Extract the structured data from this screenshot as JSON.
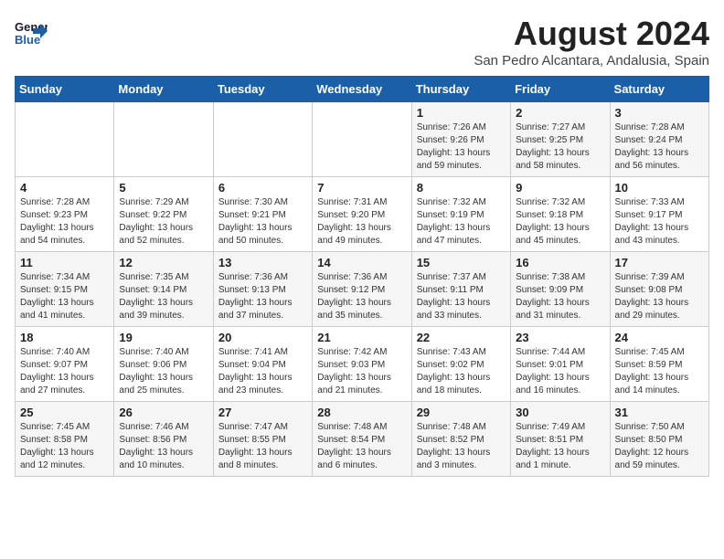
{
  "header": {
    "logo_line1": "General",
    "logo_line2": "Blue",
    "title": "August 2024",
    "subtitle": "San Pedro Alcantara, Andalusia, Spain"
  },
  "days_of_week": [
    "Sunday",
    "Monday",
    "Tuesday",
    "Wednesday",
    "Thursday",
    "Friday",
    "Saturday"
  ],
  "weeks": [
    [
      {
        "day": "",
        "info": ""
      },
      {
        "day": "",
        "info": ""
      },
      {
        "day": "",
        "info": ""
      },
      {
        "day": "",
        "info": ""
      },
      {
        "day": "1",
        "info": "Sunrise: 7:26 AM\nSunset: 9:26 PM\nDaylight: 13 hours\nand 59 minutes."
      },
      {
        "day": "2",
        "info": "Sunrise: 7:27 AM\nSunset: 9:25 PM\nDaylight: 13 hours\nand 58 minutes."
      },
      {
        "day": "3",
        "info": "Sunrise: 7:28 AM\nSunset: 9:24 PM\nDaylight: 13 hours\nand 56 minutes."
      }
    ],
    [
      {
        "day": "4",
        "info": "Sunrise: 7:28 AM\nSunset: 9:23 PM\nDaylight: 13 hours\nand 54 minutes."
      },
      {
        "day": "5",
        "info": "Sunrise: 7:29 AM\nSunset: 9:22 PM\nDaylight: 13 hours\nand 52 minutes."
      },
      {
        "day": "6",
        "info": "Sunrise: 7:30 AM\nSunset: 9:21 PM\nDaylight: 13 hours\nand 50 minutes."
      },
      {
        "day": "7",
        "info": "Sunrise: 7:31 AM\nSunset: 9:20 PM\nDaylight: 13 hours\nand 49 minutes."
      },
      {
        "day": "8",
        "info": "Sunrise: 7:32 AM\nSunset: 9:19 PM\nDaylight: 13 hours\nand 47 minutes."
      },
      {
        "day": "9",
        "info": "Sunrise: 7:32 AM\nSunset: 9:18 PM\nDaylight: 13 hours\nand 45 minutes."
      },
      {
        "day": "10",
        "info": "Sunrise: 7:33 AM\nSunset: 9:17 PM\nDaylight: 13 hours\nand 43 minutes."
      }
    ],
    [
      {
        "day": "11",
        "info": "Sunrise: 7:34 AM\nSunset: 9:15 PM\nDaylight: 13 hours\nand 41 minutes."
      },
      {
        "day": "12",
        "info": "Sunrise: 7:35 AM\nSunset: 9:14 PM\nDaylight: 13 hours\nand 39 minutes."
      },
      {
        "day": "13",
        "info": "Sunrise: 7:36 AM\nSunset: 9:13 PM\nDaylight: 13 hours\nand 37 minutes."
      },
      {
        "day": "14",
        "info": "Sunrise: 7:36 AM\nSunset: 9:12 PM\nDaylight: 13 hours\nand 35 minutes."
      },
      {
        "day": "15",
        "info": "Sunrise: 7:37 AM\nSunset: 9:11 PM\nDaylight: 13 hours\nand 33 minutes."
      },
      {
        "day": "16",
        "info": "Sunrise: 7:38 AM\nSunset: 9:09 PM\nDaylight: 13 hours\nand 31 minutes."
      },
      {
        "day": "17",
        "info": "Sunrise: 7:39 AM\nSunset: 9:08 PM\nDaylight: 13 hours\nand 29 minutes."
      }
    ],
    [
      {
        "day": "18",
        "info": "Sunrise: 7:40 AM\nSunset: 9:07 PM\nDaylight: 13 hours\nand 27 minutes."
      },
      {
        "day": "19",
        "info": "Sunrise: 7:40 AM\nSunset: 9:06 PM\nDaylight: 13 hours\nand 25 minutes."
      },
      {
        "day": "20",
        "info": "Sunrise: 7:41 AM\nSunset: 9:04 PM\nDaylight: 13 hours\nand 23 minutes."
      },
      {
        "day": "21",
        "info": "Sunrise: 7:42 AM\nSunset: 9:03 PM\nDaylight: 13 hours\nand 21 minutes."
      },
      {
        "day": "22",
        "info": "Sunrise: 7:43 AM\nSunset: 9:02 PM\nDaylight: 13 hours\nand 18 minutes."
      },
      {
        "day": "23",
        "info": "Sunrise: 7:44 AM\nSunset: 9:01 PM\nDaylight: 13 hours\nand 16 minutes."
      },
      {
        "day": "24",
        "info": "Sunrise: 7:45 AM\nSunset: 8:59 PM\nDaylight: 13 hours\nand 14 minutes."
      }
    ],
    [
      {
        "day": "25",
        "info": "Sunrise: 7:45 AM\nSunset: 8:58 PM\nDaylight: 13 hours\nand 12 minutes."
      },
      {
        "day": "26",
        "info": "Sunrise: 7:46 AM\nSunset: 8:56 PM\nDaylight: 13 hours\nand 10 minutes."
      },
      {
        "day": "27",
        "info": "Sunrise: 7:47 AM\nSunset: 8:55 PM\nDaylight: 13 hours\nand 8 minutes."
      },
      {
        "day": "28",
        "info": "Sunrise: 7:48 AM\nSunset: 8:54 PM\nDaylight: 13 hours\nand 6 minutes."
      },
      {
        "day": "29",
        "info": "Sunrise: 7:48 AM\nSunset: 8:52 PM\nDaylight: 13 hours\nand 3 minutes."
      },
      {
        "day": "30",
        "info": "Sunrise: 7:49 AM\nSunset: 8:51 PM\nDaylight: 13 hours\nand 1 minute."
      },
      {
        "day": "31",
        "info": "Sunrise: 7:50 AM\nSunset: 8:50 PM\nDaylight: 12 hours\nand 59 minutes."
      }
    ]
  ]
}
